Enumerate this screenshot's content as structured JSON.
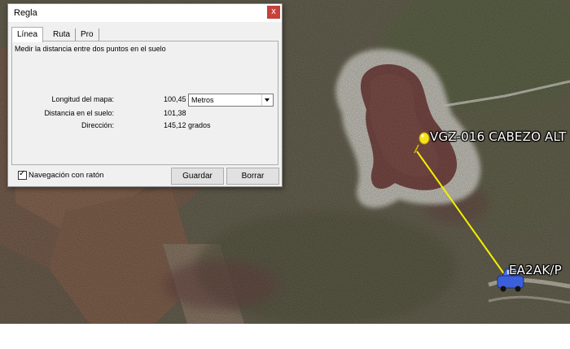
{
  "dialog": {
    "title": "Regla",
    "close_glyph": "x",
    "tabs": [
      {
        "label": "Línea",
        "active": true
      },
      {
        "label": "Ruta",
        "active": false
      },
      {
        "label": "Pro",
        "active": false
      }
    ],
    "description": "Medir la distancia entre dos puntos en el suelo",
    "map_length": {
      "label": "Longitud del mapa:",
      "value": "100,45",
      "unit_selected": "Metros"
    },
    "ground_distance": {
      "label": "Distancia en el suelo:",
      "value": "101,38"
    },
    "direction": {
      "label": "Dirección:",
      "value": "145,12 grados"
    },
    "mouse_navigation": {
      "label": "Navegación con ratón",
      "checked": true
    },
    "buttons": {
      "save": "Guardar",
      "clear": "Borrar"
    }
  },
  "map": {
    "placemark_label": "VGZ-016 CABEZO ALT",
    "vehicle_label": "EA2AK/P",
    "pin_icon": "yellow-pushpin-icon",
    "vehicle_icon": "car-icon",
    "ruler_line_color": "#f4f000"
  }
}
